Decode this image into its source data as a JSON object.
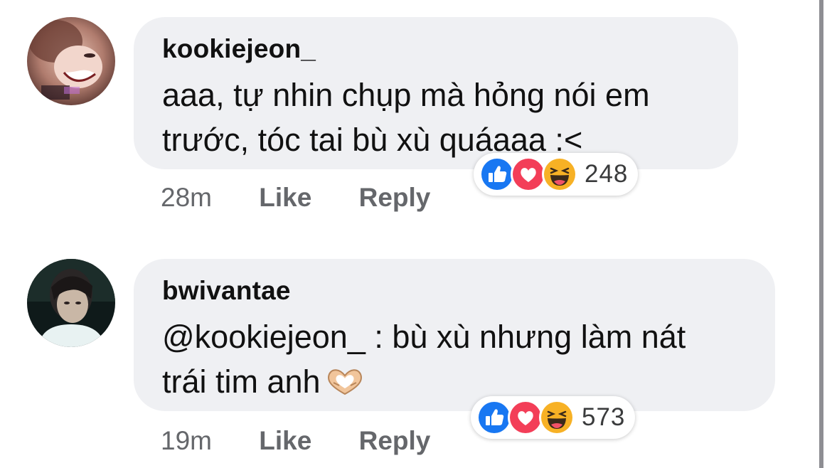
{
  "comments": [
    {
      "username": "kookiejeon_",
      "text_line1": "aaa, tự nhin chụp mà hỏng nói em",
      "text_line2": "trước, tóc tai bù xù quáaaa :<",
      "time": "28m",
      "like_label": "Like",
      "reply_label": "Reply",
      "reactions": [
        "like",
        "love",
        "haha"
      ],
      "reaction_count": "248"
    },
    {
      "username": "bwivantae",
      "text_line1": "@kookiejeon_ : bù xù nhưng làm nát",
      "text_line2": "trái tim anh",
      "text_emoji": "heart-hands-emoji",
      "time": "19m",
      "like_label": "Like",
      "reply_label": "Reply",
      "reactions": [
        "like",
        "love",
        "haha"
      ],
      "reaction_count": "573"
    }
  ],
  "colors": {
    "bubble": "#eff0f3",
    "like": "#1877f2",
    "love": "#f33e58",
    "haha": "#f7b125",
    "meta_text": "#65676b"
  }
}
